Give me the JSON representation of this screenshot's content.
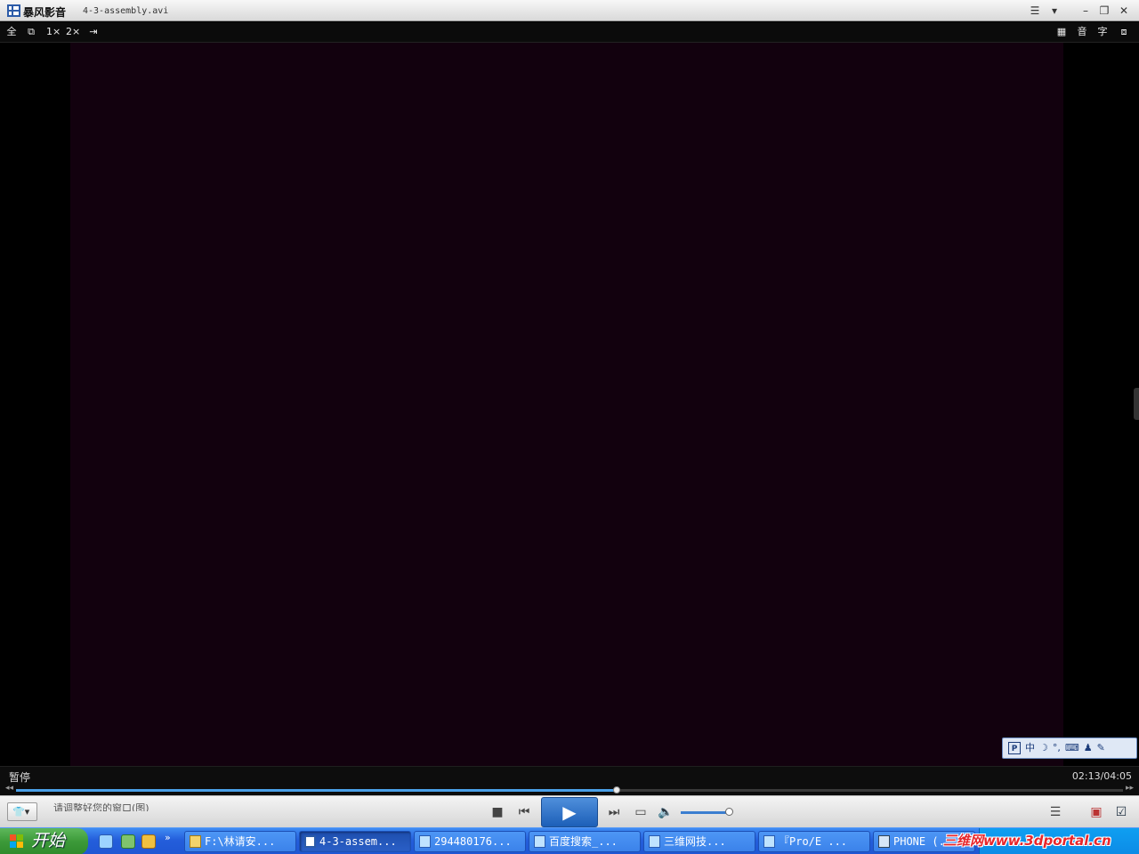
{
  "window": {
    "app_name": "暴风影音",
    "file_name": "4-3-assembly.avi",
    "controls": {
      "menu": "☰",
      "skin": "▾",
      "minimize": "–",
      "restore": "❐",
      "close": "✕"
    }
  },
  "toolbar": {
    "fullscreen": "全",
    "mini": "⧉",
    "size_1x": "1×",
    "size_2x": "2×",
    "pin": "⇥",
    "right_list": "▦",
    "audio": "音",
    "subtitle": "字",
    "exit": "⧈"
  },
  "ime": {
    "logo": "P",
    "lang": "中",
    "moon": "☽",
    "punct": "°,",
    "keyboard": "⌨",
    "user": "♟",
    "tool": "✎"
  },
  "status": {
    "state": "暂停",
    "time": "02:13/04:05"
  },
  "progress": {
    "fraction": 0.543,
    "left_arrow": "◂◂",
    "right_arrow": "▸▸"
  },
  "controls": {
    "skin_label": "👕▾",
    "marquee": "请调整好您的窗口(图)",
    "stop": "■",
    "prev": "⏮",
    "play": "▶",
    "next": "⏭",
    "open": "▭",
    "mute": "🔈",
    "volume_fraction": 1.0,
    "playlist": "☰",
    "toolbox": "▣",
    "extra": "☑"
  },
  "taskbar": {
    "start_label": "开始",
    "overflow": "»",
    "tasks": [
      {
        "label": "F:\\林请安..."
      },
      {
        "label": "4-3-assem..."
      },
      {
        "label": "294480176..."
      },
      {
        "label": "百度搜索_..."
      },
      {
        "label": "三维网技..."
      },
      {
        "label": "『Pro/E ..."
      },
      {
        "label": "PHONE (..."
      }
    ]
  },
  "watermark": "三维网www.3dportal.cn"
}
